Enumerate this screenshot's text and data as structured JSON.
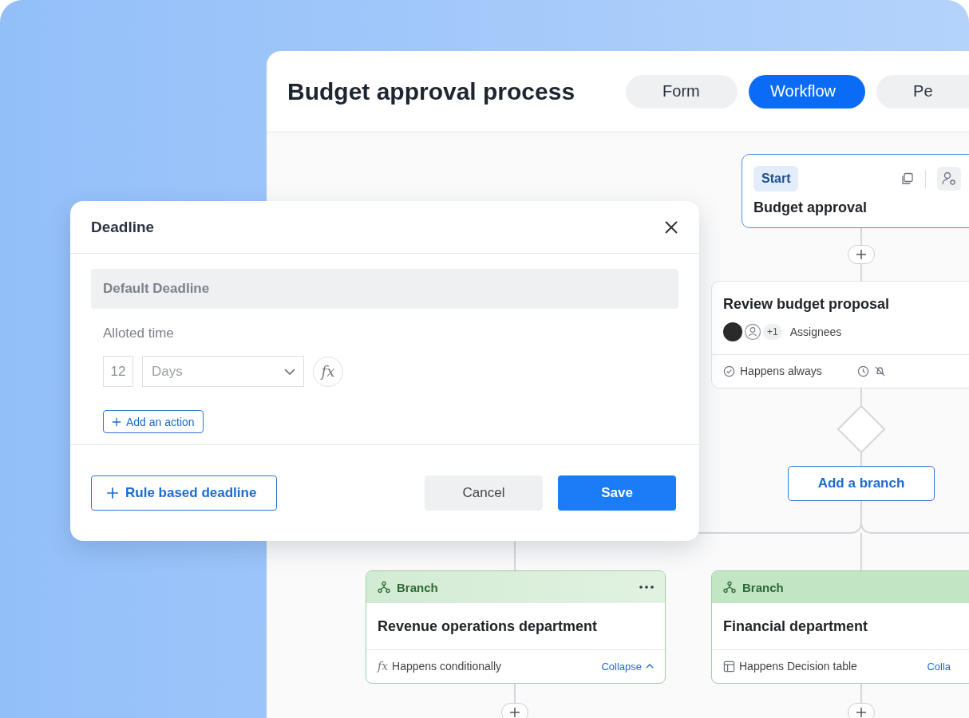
{
  "title": "Budget approval process",
  "page_tabs": [
    {
      "label": "Form",
      "selected": false
    },
    {
      "label": "Workflow",
      "selected": true
    },
    {
      "label": "Pe",
      "selected": false
    }
  ],
  "workflow": {
    "start_node": {
      "badge": "Start",
      "title": "Budget approval"
    },
    "task_node": {
      "title": "Review budget proposal",
      "assignee_extra": "+1",
      "assignees_label": "Assignees",
      "condition": "Happens always"
    },
    "add_branch_button": "Add a branch",
    "branches": [
      {
        "label": "Branch",
        "title": "Revenue operations department",
        "kind": "formula",
        "condition_symbol": "fx",
        "condition": "Happens conditionally",
        "collapse_link": "Collapse",
        "highlighted": false
      },
      {
        "label": "Branch",
        "title": "Financial department",
        "kind": "table",
        "condition": "Happens Decision table",
        "collapse_link": "Colla",
        "highlighted": true
      }
    ]
  },
  "dialog": {
    "title": "Deadline",
    "section_label": "Default Deadline",
    "field_label": "Alloted time",
    "amount": "12",
    "unit": "Days",
    "formula_symbol": "fx",
    "add_action": "Add an action",
    "rule_button": "Rule based deadline",
    "cancel": "Cancel",
    "save": "Save"
  }
}
